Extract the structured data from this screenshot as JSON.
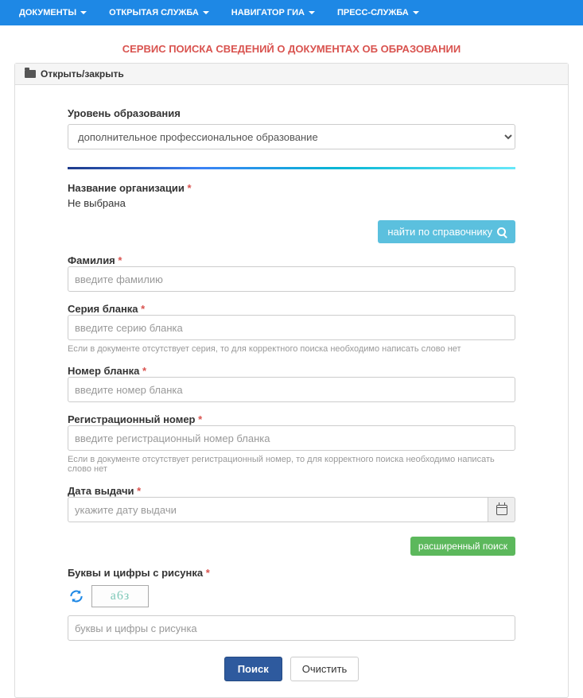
{
  "nav": {
    "items": [
      {
        "label": "ДОКУМЕНТЫ"
      },
      {
        "label": "ОТКРЫТАЯ СЛУЖБА"
      },
      {
        "label": "НАВИГАТОР ГИА"
      },
      {
        "label": "ПРЕСС-СЛУЖБА"
      }
    ]
  },
  "page": {
    "title": "СЕРВИС ПОИСКА СВЕДЕНИЙ О ДОКУМЕНТАХ ОБ ОБРАЗОВАНИИ"
  },
  "panel": {
    "toggle_label": "Открыть/закрыть"
  },
  "form": {
    "education_level": {
      "label": "Уровень образования",
      "selected": "дополнительное профессиональное образование"
    },
    "org": {
      "label": "Название организации",
      "not_selected": "Не выбрана",
      "find_btn": "найти по справочнику"
    },
    "surname": {
      "label": "Фамилия",
      "placeholder": "введите фамилию"
    },
    "blank_series": {
      "label": "Серия бланка",
      "placeholder": "введите серию бланка",
      "hint": "Если в документе отсутствует серия, то для корректного поиска необходимо написать слово нет"
    },
    "blank_number": {
      "label": "Номер бланка",
      "placeholder": "введите номер бланка"
    },
    "reg_number": {
      "label": "Регистрационный номер",
      "placeholder": "введите регистрационный номер бланка",
      "hint": "Если в документе отсутствует регистрационный номер, то для корректного поиска необходимо написать слово нет"
    },
    "issue_date": {
      "label": "Дата выдачи",
      "placeholder": "укажите дату выдачи"
    },
    "ext_search_btn": "расширенный поиск",
    "captcha": {
      "label": "Буквы и цифры с рисунка",
      "placeholder": "буквы и цифры с рисунка",
      "sample": "а6з"
    },
    "actions": {
      "search": "Поиск",
      "clear": "Очистить"
    }
  }
}
